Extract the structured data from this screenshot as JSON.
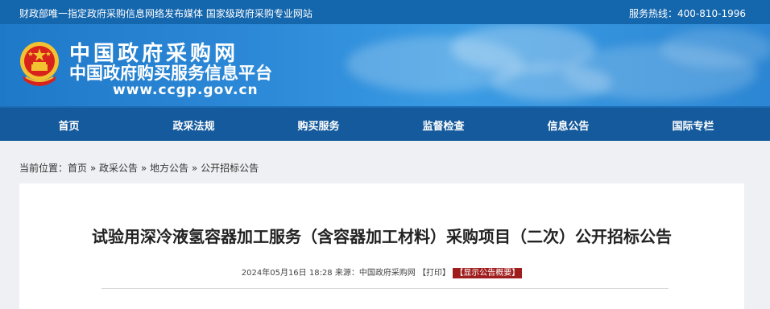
{
  "topbar": {
    "left_text": "财政部唯一指定政府采购信息网络发布媒体 国家级政府采购专业网站",
    "hotline": "服务热线：400-810-1996"
  },
  "logo": {
    "title": "中国政府采购网",
    "subtitle": "中国政府购买服务信息平台",
    "url": "www.ccgp.gov.cn"
  },
  "nav": {
    "items": [
      {
        "label": "首页"
      },
      {
        "label": "政采法规"
      },
      {
        "label": "购买服务"
      },
      {
        "label": "监督检查"
      },
      {
        "label": "信息公告"
      },
      {
        "label": "国际专栏"
      }
    ]
  },
  "breadcrumb": {
    "prefix": "当前位置：",
    "items": [
      "首页",
      "政采公告",
      "地方公告",
      "公开招标公告"
    ],
    "separator": "»"
  },
  "article": {
    "title": "试验用深冷液氢容器加工服务（含容器加工材料）采购项目（二次）公开招标公告",
    "datetime": "2024年05月16日 18:28",
    "source": "来源：中国政府采购网",
    "print_label": "【打印】",
    "summary_label": "【显示公告概要】"
  },
  "colors": {
    "topbar": "#1466ad",
    "nav": "#145a9c",
    "badge": "#a01d1d"
  },
  "icons": {
    "emblem": "national-emblem-icon"
  }
}
